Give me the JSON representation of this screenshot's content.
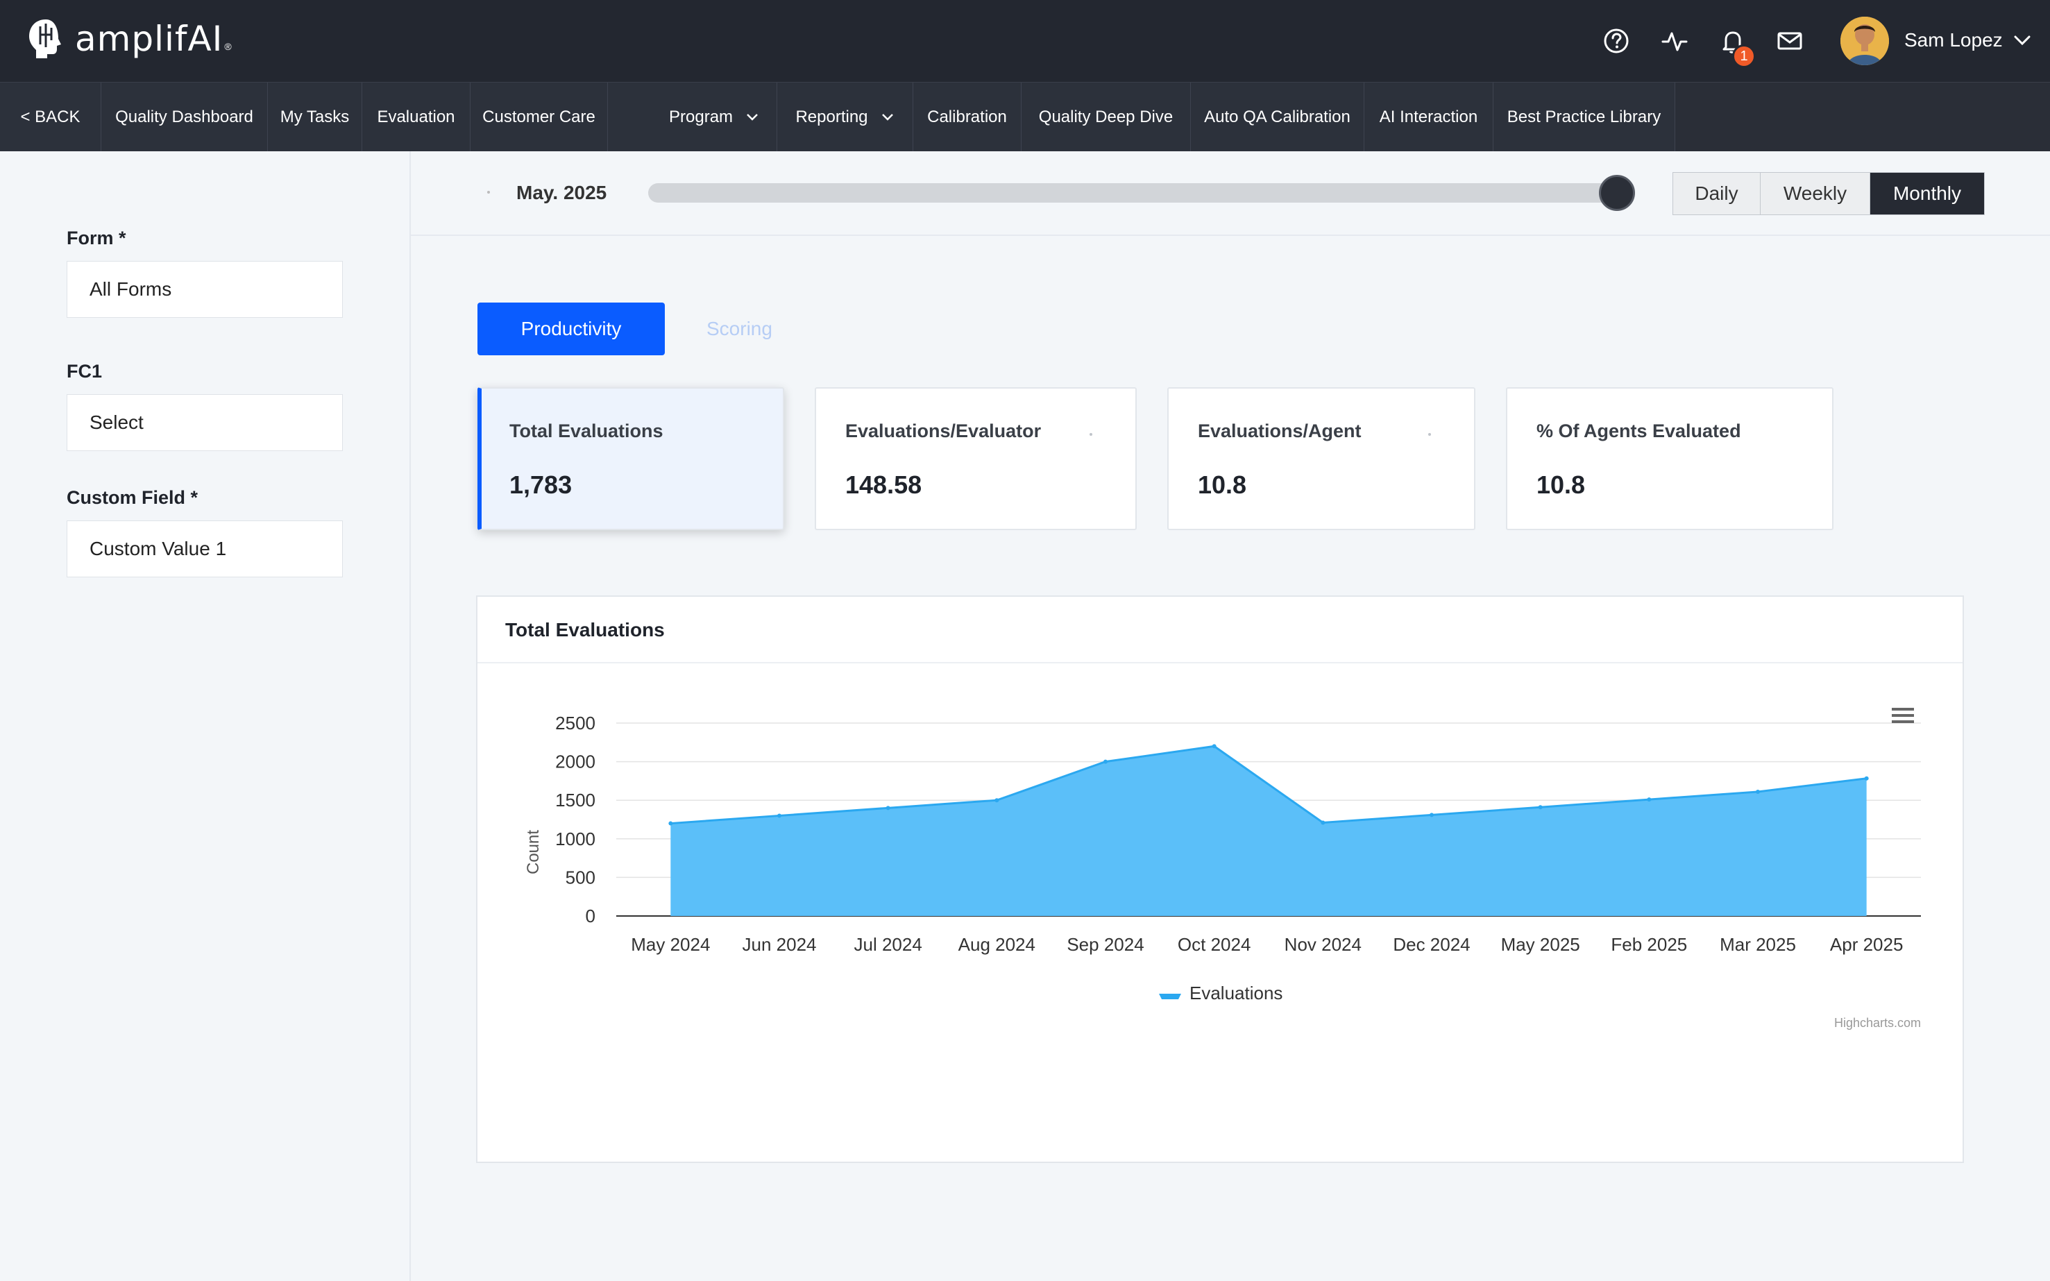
{
  "app": {
    "logo_text": "amplifAI",
    "logo_reg": "®"
  },
  "header": {
    "icons": [
      "help-icon",
      "activity-icon",
      "bell-icon",
      "mail-icon"
    ],
    "notification_count": "1",
    "user_name": "Sam Lopez"
  },
  "nav": {
    "items": [
      {
        "label": "< BACK"
      },
      {
        "label": "Quality Dashboard"
      },
      {
        "label": "My Tasks"
      },
      {
        "label": "Evaluation"
      },
      {
        "label": "Customer Care"
      },
      {
        "label": "Program",
        "dropdown": true
      },
      {
        "label": "Reporting",
        "dropdown": true
      },
      {
        "label": "Calibration"
      },
      {
        "label": "Quality Deep Dive"
      },
      {
        "label": "Auto QA Calibration"
      },
      {
        "label": "AI Interaction"
      },
      {
        "label": "Best Practice Library"
      }
    ]
  },
  "filters": {
    "form_label": "Form *",
    "form_value": "All Forms",
    "fc1_label": "FC1",
    "fc1_value": "Select",
    "custom_label": "Custom Field *",
    "custom_value": "Custom Value 1"
  },
  "period": {
    "label": "May. 2025",
    "slider_position": 1.0,
    "options": [
      "Daily",
      "Weekly",
      "Monthly"
    ],
    "selected": "Monthly"
  },
  "tabs": {
    "primary": "Productivity",
    "secondary": "Scoring"
  },
  "kpis": [
    {
      "label": "Total Evaluations",
      "value": "1,783"
    },
    {
      "label": "Evaluations/Evaluator",
      "value": "148.58"
    },
    {
      "label": "Evaluations/Agent",
      "value": "10.8"
    },
    {
      "label": "% Of Agents Evaluated",
      "value": "10.8"
    }
  ],
  "colors": {
    "accent": "#0a5cff",
    "area_fill": "#5bbff9",
    "area_line": "#2ba8f0",
    "header_bg": "#232730",
    "badge": "#f05a28"
  },
  "chart_card": {
    "title": "Total Evaluations",
    "menu_icon": "hamburger-menu-icon",
    "credits": "Highcharts.com"
  },
  "chart_data": {
    "type": "area",
    "title": "",
    "xlabel": "",
    "ylabel": "Count",
    "ylim": [
      0,
      2500
    ],
    "yticks": [
      0,
      500,
      1000,
      1500,
      2000,
      2500
    ],
    "grid": true,
    "legend": "bottom-center",
    "categories": [
      "May 2024",
      "Jun 2024",
      "Jul 2024",
      "Aug 2024",
      "Sep 2024",
      "Oct 2024",
      "Nov 2024",
      "Dec 2024",
      "May 2025",
      "Feb 2025",
      "Mar 2025",
      "Apr 2025"
    ],
    "series": [
      {
        "name": "Evaluations",
        "values": [
          1200,
          1300,
          1400,
          1500,
          2000,
          2200,
          1210,
          1310,
          1410,
          1510,
          1610,
          1783
        ]
      }
    ]
  }
}
